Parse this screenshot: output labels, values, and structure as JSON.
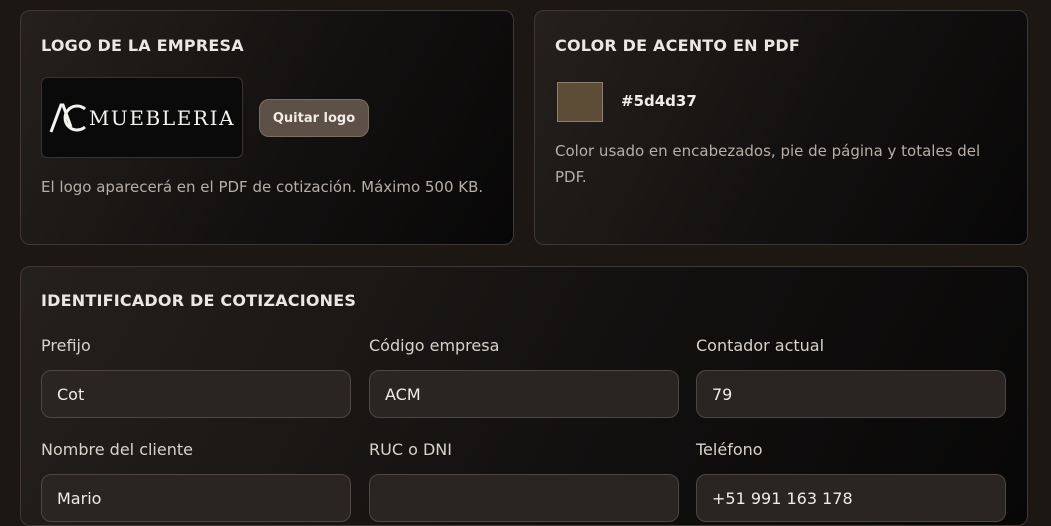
{
  "logo_card": {
    "title": "LOGO DE LA EMPRESA",
    "logo_text": "MUEBLERIA",
    "remove_button": "Quitar logo",
    "help": "El logo aparecerá en el PDF de cotización. Máximo 500 KB."
  },
  "color_card": {
    "title": "COLOR DE ACENTO EN PDF",
    "hex": "#5d4d37",
    "help": "Color usado en encabezados, pie de página y totales del PDF."
  },
  "identifier_card": {
    "title": "IDENTIFICADOR DE COTIZACIONES",
    "fields": [
      {
        "label": "Prefijo",
        "value": "Cot"
      },
      {
        "label": "Código empresa",
        "value": "ACM"
      },
      {
        "label": "Contador actual",
        "value": "79"
      },
      {
        "label": "Nombre del cliente",
        "value": "Mario"
      },
      {
        "label": "RUC o DNI",
        "value": ""
      },
      {
        "label": "Teléfono",
        "value": "+51 991 163 178"
      }
    ]
  },
  "colors": {
    "accent": "#5d4d37",
    "background": "#1d1714",
    "button": "#5c5047"
  },
  "icons": {
    "logo": "ac-monogram-icon"
  }
}
